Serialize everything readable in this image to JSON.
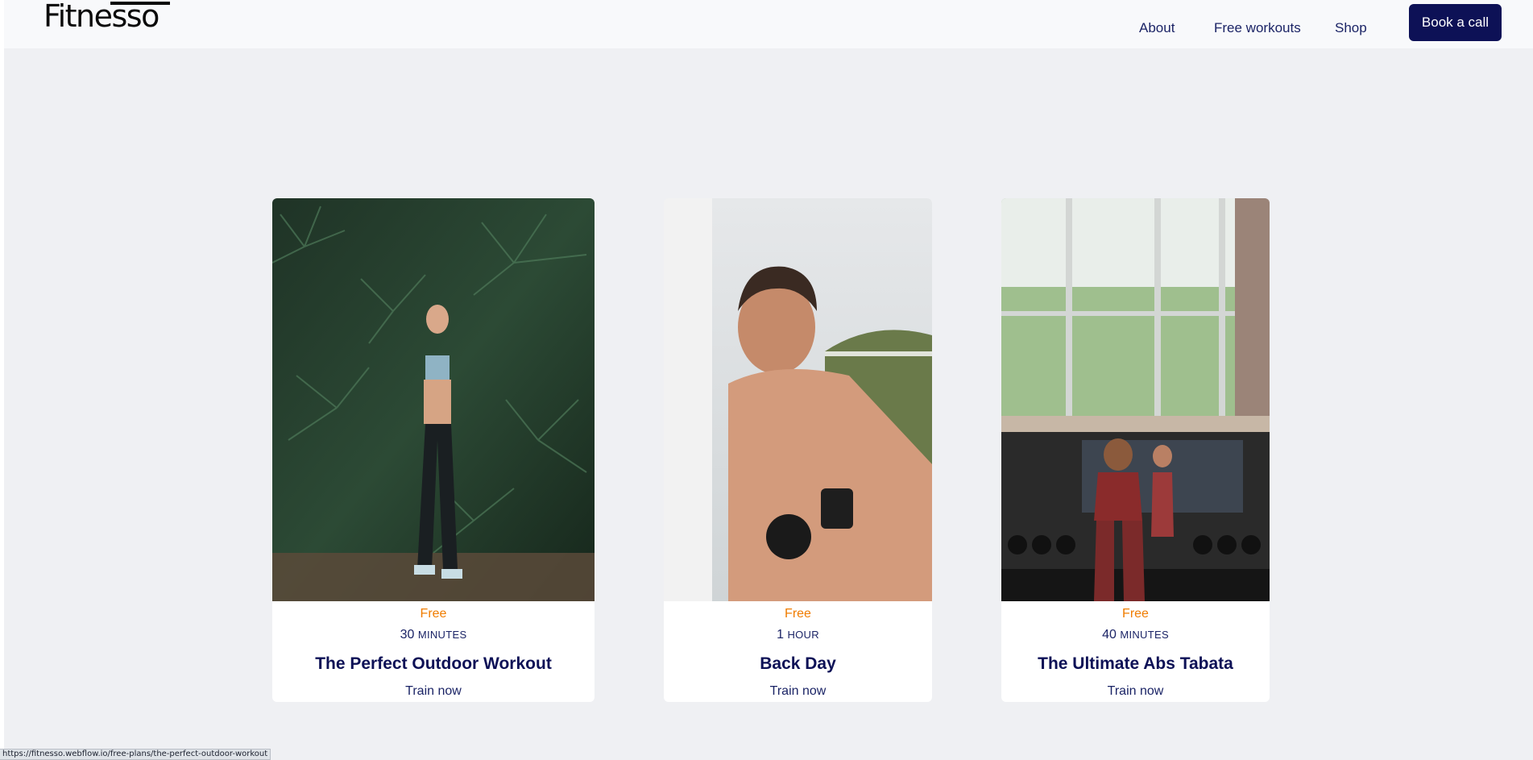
{
  "brand": {
    "logo_text": "Fitnesso"
  },
  "nav": {
    "items": [
      {
        "label": "About"
      },
      {
        "label": "Free workouts"
      },
      {
        "label": "Shop"
      }
    ],
    "cta_label": "Book a call"
  },
  "cards": [
    {
      "price": "Free",
      "duration_number": "30",
      "duration_unit": "minutes",
      "title": "The Perfect Outdoor Workout",
      "cta": "Train now",
      "image": "woman-in-tropical-foliage-photo"
    },
    {
      "price": "Free",
      "duration_number": "1",
      "duration_unit": "hour",
      "title": "Back Day",
      "cta": "Train now",
      "image": "man-lifting-kettlebell-photo"
    },
    {
      "price": "Free",
      "duration_number": "40",
      "duration_unit": "minutes",
      "title": "The Ultimate Abs Tabata",
      "cta": "Train now",
      "image": "gym-mirror-window-photo"
    }
  ],
  "status_bar": {
    "url": "https://fitnesso.webflow.io/free-plans/the-perfect-outdoor-workout"
  },
  "colors": {
    "accent": "#0d1156",
    "price": "#f07c00",
    "text": "#1b2466",
    "background": "#eff0f3"
  }
}
